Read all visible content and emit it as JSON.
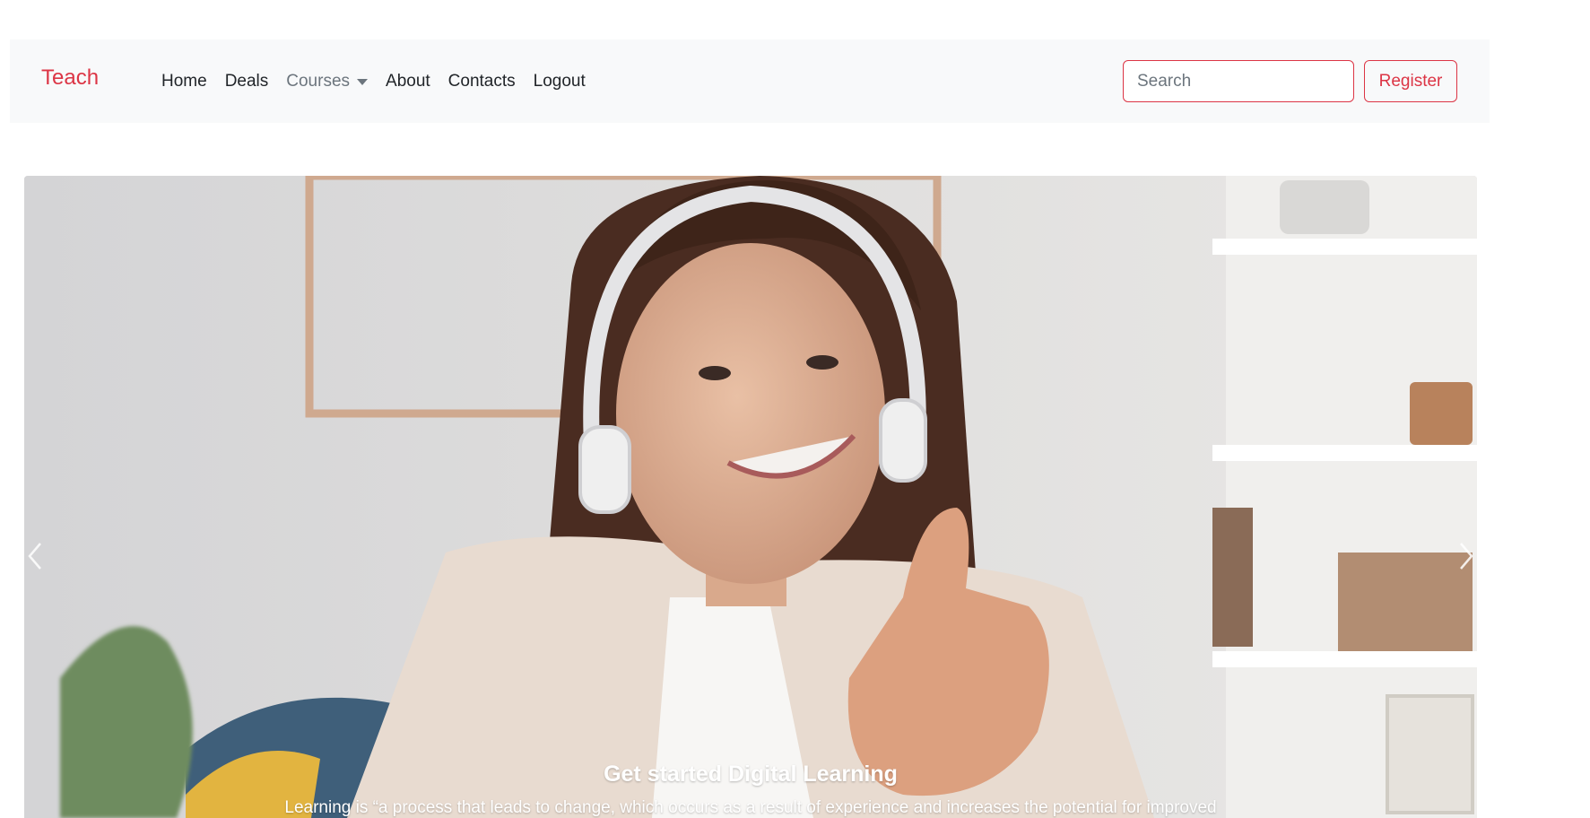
{
  "navbar": {
    "brand": "Teach",
    "links": [
      {
        "label": "Home"
      },
      {
        "label": "Deals"
      },
      {
        "label": "Courses"
      },
      {
        "label": "About"
      },
      {
        "label": "Contacts"
      },
      {
        "label": "Logout"
      }
    ],
    "search_placeholder": "Search",
    "register_label": "Register"
  },
  "carousel": {
    "caption_title": "Get started Digital Learning",
    "caption_text": "Learning is “a process that leads to change, which occurs as a result of experience and increases the potential for improved"
  },
  "colors": {
    "accent": "#dc3545",
    "navbar_bg": "#f8f9fa",
    "link": "#212529",
    "muted_link": "#6c757d"
  },
  "icons": [
    "caret-down-icon",
    "chevron-left-icon",
    "chevron-right-icon"
  ]
}
